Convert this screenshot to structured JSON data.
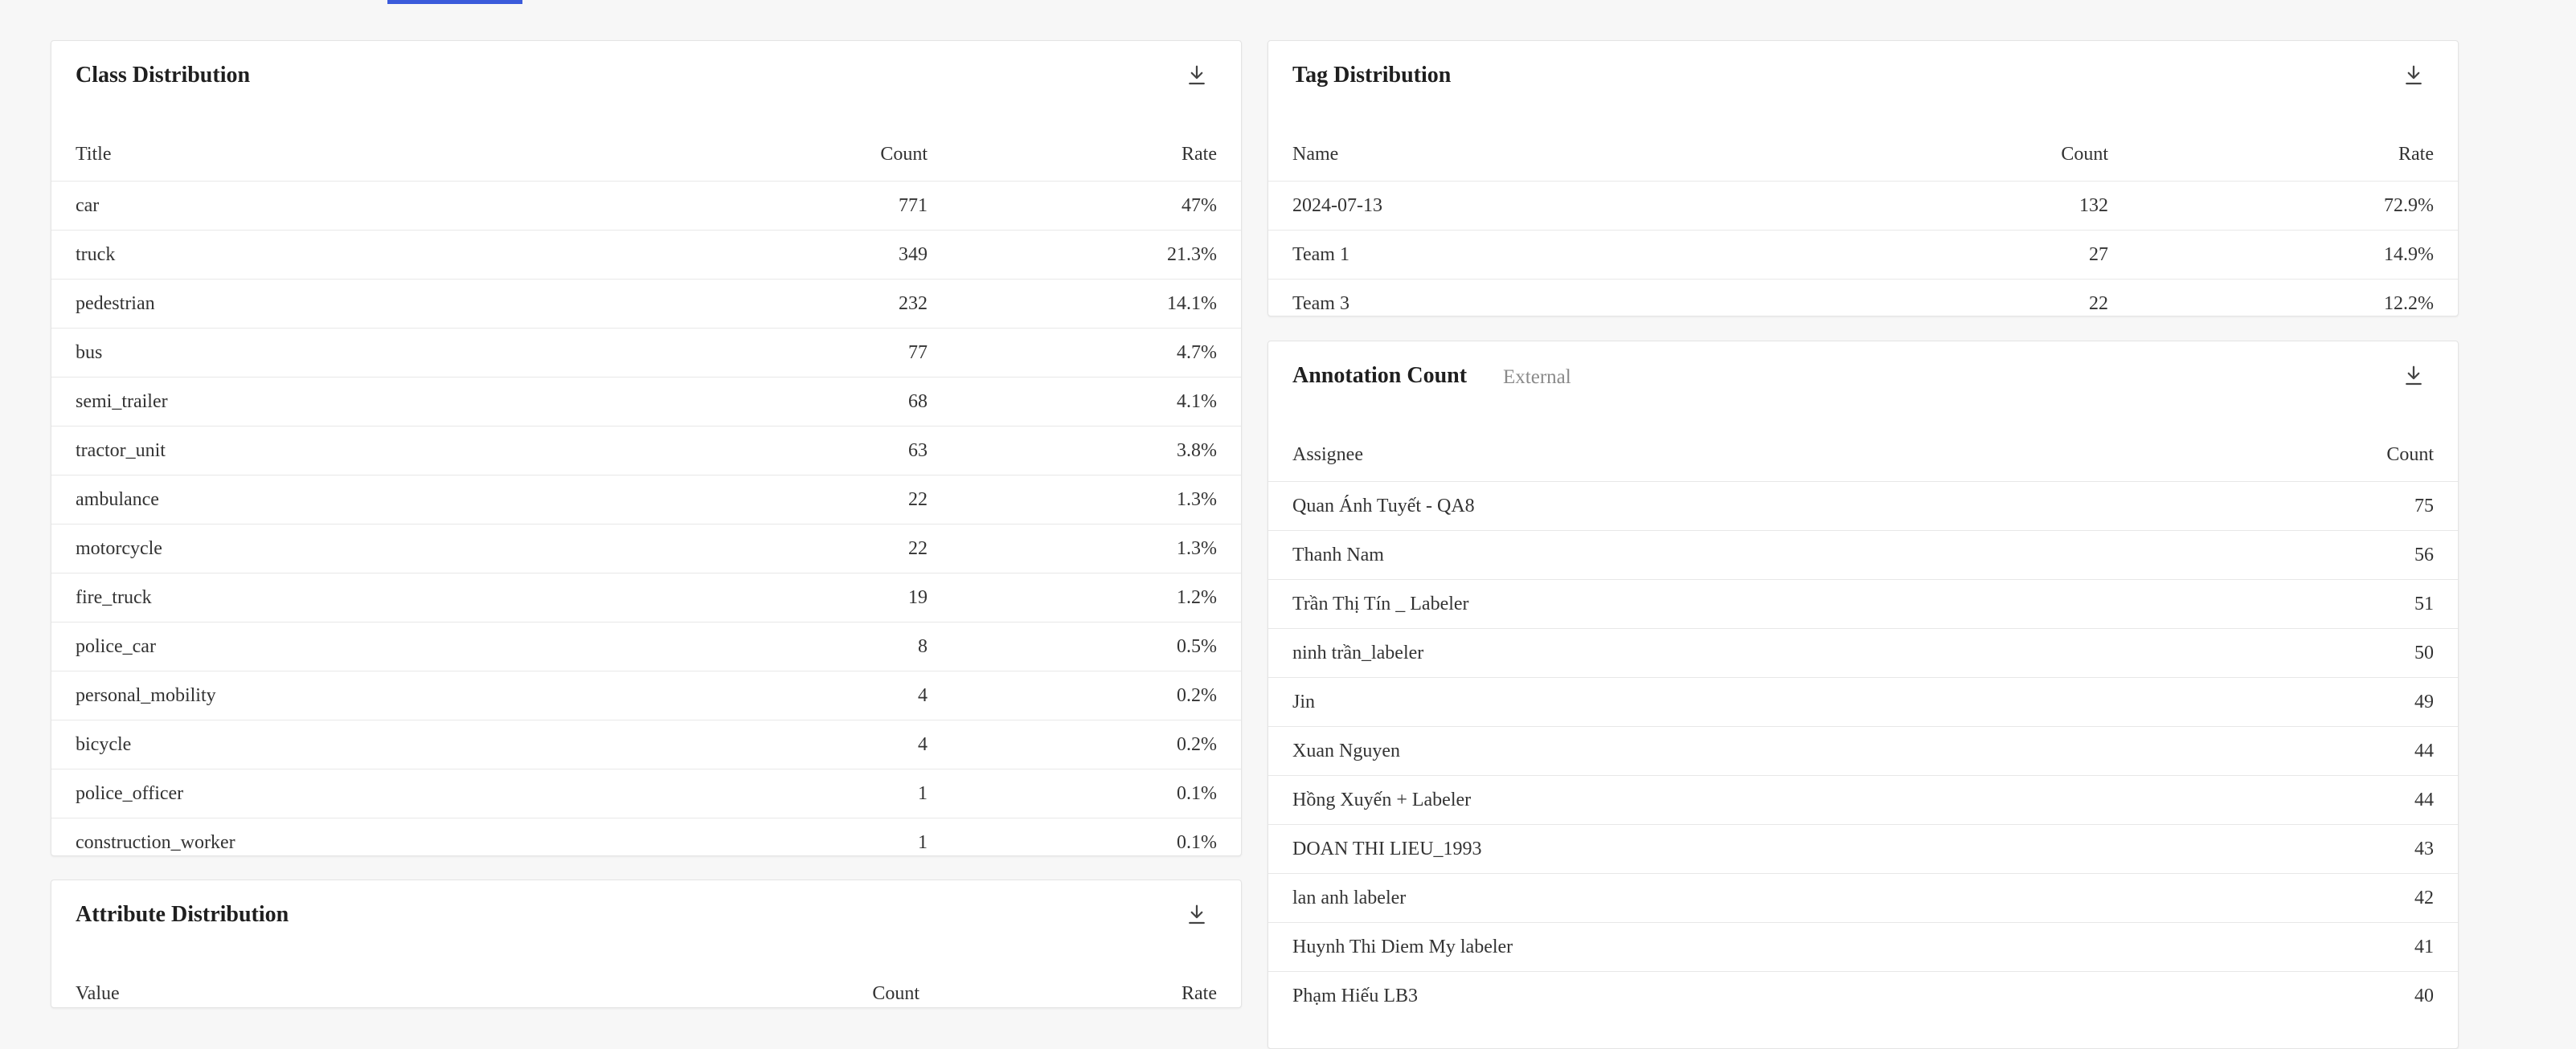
{
  "class_distribution": {
    "title": "Class Distribution",
    "columns": [
      "Title",
      "Count",
      "Rate"
    ],
    "rows": [
      [
        "car",
        "771",
        "47%"
      ],
      [
        "truck",
        "349",
        "21.3%"
      ],
      [
        "pedestrian",
        "232",
        "14.1%"
      ],
      [
        "bus",
        "77",
        "4.7%"
      ],
      [
        "semi_trailer",
        "68",
        "4.1%"
      ],
      [
        "tractor_unit",
        "63",
        "3.8%"
      ],
      [
        "ambulance",
        "22",
        "1.3%"
      ],
      [
        "motorcycle",
        "22",
        "1.3%"
      ],
      [
        "fire_truck",
        "19",
        "1.2%"
      ],
      [
        "police_car",
        "8",
        "0.5%"
      ],
      [
        "personal_mobility",
        "4",
        "0.2%"
      ],
      [
        "bicycle",
        "4",
        "0.2%"
      ],
      [
        "police_officer",
        "1",
        "0.1%"
      ],
      [
        "construction_worker",
        "1",
        "0.1%"
      ]
    ]
  },
  "attribute_distribution": {
    "title": "Attribute Distribution",
    "columns": [
      "Value",
      "Count",
      "Rate"
    ],
    "rows": []
  },
  "tag_distribution": {
    "title": "Tag Distribution",
    "columns": [
      "Name",
      "Count",
      "Rate"
    ],
    "rows": [
      [
        "2024-07-13",
        "132",
        "72.9%"
      ],
      [
        "Team 1",
        "27",
        "14.9%"
      ],
      [
        "Team 3",
        "22",
        "12.2%"
      ]
    ]
  },
  "annotation_count": {
    "title": "Annotation Count",
    "subtitle": "External",
    "columns": [
      "Assignee",
      "Count"
    ],
    "rows": [
      [
        "Quan Ánh Tuyết - QA8",
        "75"
      ],
      [
        "Thanh Nam",
        "56"
      ],
      [
        "Trần Thị Tín _ Labeler",
        "51"
      ],
      [
        "ninh trần_labeler",
        "50"
      ],
      [
        "Jin",
        "49"
      ],
      [
        "Xuan Nguyen",
        "44"
      ],
      [
        "Hồng Xuyến + Labeler",
        "44"
      ],
      [
        "DOAN THI LIEU_1993",
        "43"
      ],
      [
        "lan anh labeler",
        "42"
      ],
      [
        "Huynh Thi Diem My labeler",
        "41"
      ],
      [
        "Phạm Hiếu LB3",
        "40"
      ]
    ]
  },
  "icons": {
    "download": "download-icon"
  },
  "colors": {
    "accent": "#3b5bdb"
  }
}
